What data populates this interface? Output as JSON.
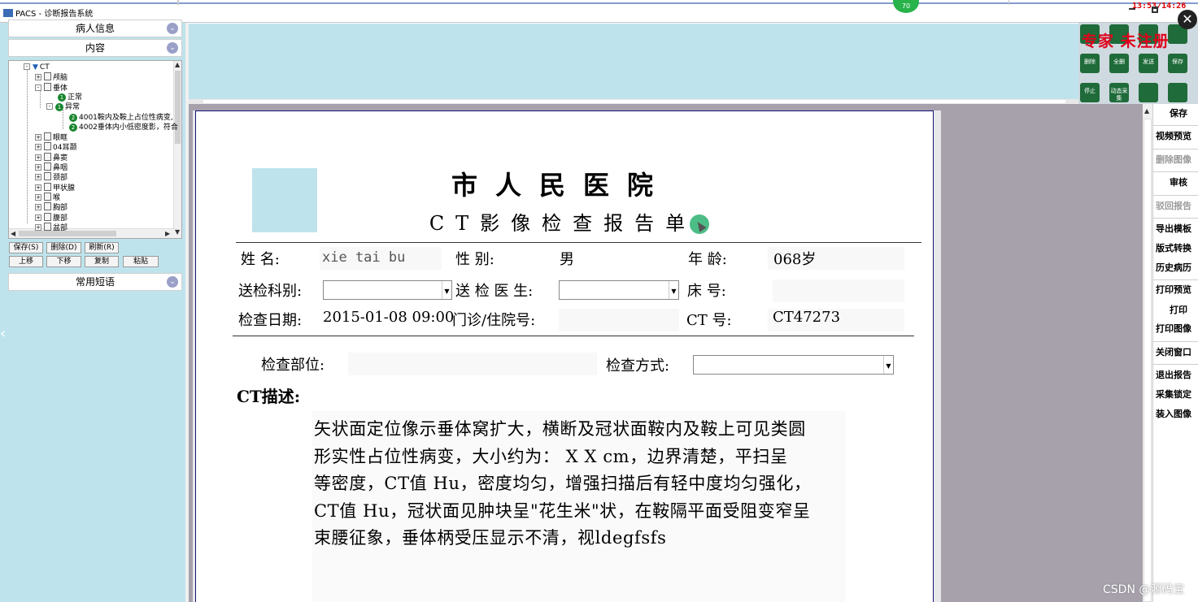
{
  "window": {
    "title": "PACS - 诊断报告系统",
    "clock": "13:53/14:26",
    "badge": "70"
  },
  "left_panel": {
    "section_patient": "病人信息",
    "section_content": "内容",
    "section_phrases": "常用短语",
    "tree": {
      "root": "CT",
      "items": [
        {
          "label": "颅脑",
          "level": 1
        },
        {
          "label": "垂体",
          "level": 1
        },
        {
          "label": "正常",
          "level": 2,
          "num": "1"
        },
        {
          "label": "异常",
          "level": 2,
          "num": "1"
        },
        {
          "label": "4001鞍内及鞍上占位性病变,",
          "level": 3,
          "num": "2"
        },
        {
          "label": "4002垂体内小低密度影，符合",
          "level": 3,
          "num": "2"
        },
        {
          "label": "眼眶",
          "level": 1
        },
        {
          "label": "04耳颞",
          "level": 1
        },
        {
          "label": "鼻窦",
          "level": 1
        },
        {
          "label": "鼻咽",
          "level": 1
        },
        {
          "label": "颈部",
          "level": 1
        },
        {
          "label": "甲状腺",
          "level": 1
        },
        {
          "label": "喉",
          "level": 1
        },
        {
          "label": "胸部",
          "level": 1
        },
        {
          "label": "腹部",
          "level": 1
        },
        {
          "label": "盆部",
          "level": 1
        }
      ]
    },
    "buttons_row1": [
      "保存(S)",
      "删除(D)",
      "刷新(R)"
    ],
    "buttons_row2": [
      "上移",
      "下移",
      "复制",
      "粘贴"
    ]
  },
  "toolbar_right": {
    "register_text": "专家 未注册",
    "icons": [
      {
        "label": "",
        "icon": "hammer-icon",
        "color": "#1f6b3a"
      },
      {
        "label": "",
        "icon": "tool-icon",
        "color": "#1f6b3a"
      },
      {
        "label": "",
        "icon": "sign-icon",
        "color": "#1f6b3a"
      },
      {
        "label": "",
        "icon": "edit-icon",
        "color": "#1f6b3a"
      },
      {
        "label": "删除",
        "icon": "delete-icon",
        "color": "#1f6b3a"
      },
      {
        "label": "全删",
        "icon": "delete-all-icon",
        "color": "#1f6b3a"
      },
      {
        "label": "发送",
        "icon": "send-icon",
        "color": "#1f6b3a"
      },
      {
        "label": "保存",
        "icon": "save-icon",
        "color": "#1f6b3a"
      },
      {
        "label": "停止",
        "icon": "stop-icon",
        "color": "#1f6b3a"
      },
      {
        "label": "动态采集",
        "icon": "capture-icon",
        "color": "#1f6b3a"
      },
      {
        "label": "",
        "icon": "globe-icon",
        "color": "#1f6b3a"
      },
      {
        "label": "",
        "icon": "globe-x-icon",
        "color": "#1f6b3a"
      }
    ]
  },
  "right_commands": [
    {
      "label": "保存",
      "enabled": true
    },
    {
      "label": "视频预览",
      "enabled": true
    },
    {
      "label": "删除图像",
      "enabled": false
    },
    {
      "label": "审核",
      "enabled": true
    },
    {
      "label": "驳回报告",
      "enabled": false
    },
    {
      "label": "导出模板",
      "enabled": true
    },
    {
      "label": "版式转换",
      "enabled": true
    },
    {
      "label": "历史病历",
      "enabled": true
    },
    {
      "label": "打印预览",
      "enabled": true
    },
    {
      "label": "打印",
      "enabled": true
    },
    {
      "label": "打印图像",
      "enabled": true
    },
    {
      "label": "关闭窗口",
      "enabled": true
    },
    {
      "label": "退出报告",
      "enabled": true
    },
    {
      "label": "采集锁定",
      "enabled": true
    },
    {
      "label": "装入图像",
      "enabled": true
    }
  ],
  "report": {
    "hospital": "市人民医院",
    "title": "CT影像检查报告单",
    "fields": {
      "name_label": "姓    名:",
      "name_value": "xie tai bu",
      "sex_label": "性      别:",
      "sex_value": "男",
      "age_label": "年    龄:",
      "age_value": "068岁",
      "dept_label": "送检科别:",
      "doctor_label": "送 检 医 生:",
      "bed_label": "床      号:",
      "date_label": "检查日期:",
      "date_value": "2015-01-08 09:00",
      "outpatient_label": "门诊/住院号:",
      "ct_label": "CT      号:",
      "ct_value": "CT47273",
      "part_label": "检查部位:",
      "method_label": "检查方式:"
    },
    "description_title": "CT描述:",
    "description_lines": [
      "矢状面定位像示垂体窝扩大，横断及冠状面鞍内及鞍上可见类圆",
      "形实性占位性病变，大小约为：  X  X  cm，边界清楚，平扫呈",
      "等密度，CT值  Hu，密度均匀，增强扫描后有轻中度均匀强化，",
      "CT值  Hu，冠状面见肿块呈\"花生米\"状，在鞍隔平面受阻变窄呈",
      "束腰征象，垂体柄受压显示不清，视ldegfsfs"
    ]
  },
  "watermark": "CSDN @源码宝"
}
